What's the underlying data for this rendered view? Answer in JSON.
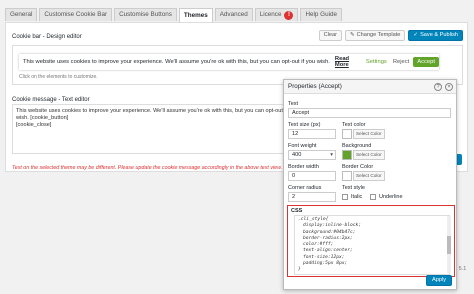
{
  "tabs": [
    {
      "label": "General"
    },
    {
      "label": "Customise Cookie Bar"
    },
    {
      "label": "Customise Buttons"
    },
    {
      "label": "Themes"
    },
    {
      "label": "Advanced"
    },
    {
      "label": "Licence",
      "badge": "!"
    },
    {
      "label": "Help Guide"
    }
  ],
  "designer": {
    "title": "Cookie bar - Design editor",
    "clear_label": "Clear",
    "change_template_label": "Change Template",
    "save_publish_label": "Save & Publish"
  },
  "preview": {
    "message": "This website uses cookies to improve your experience. We'll assume you're ok with this, but you can opt-out if you wish.",
    "read_more": "Read More",
    "settings": "Settings",
    "reject": "Reject",
    "accept": "Accept",
    "hint": "Click on the elements to customize."
  },
  "message_editor": {
    "label": "Cookie message - Text editor",
    "line1": "This website uses cookies to improve your experience. We'll assume you're ok with this, but you can opt-out if you",
    "line2": "wish. [cookie_button]",
    "line3": "[cookie_close]"
  },
  "warning": "Text on the selected theme may be different. Please update the cookie message accordingly in the above text view.",
  "version_text": "on 5.1",
  "properties": {
    "title": "Properties (Accept)",
    "text_label": "Text",
    "text_value": "Accept",
    "text_size_label": "Text size (px)",
    "text_size_value": "12",
    "text_color_label": "Text color",
    "text_color_button": "Select Color",
    "text_color": "#ffffff",
    "font_weight_label": "Font weight",
    "font_weight_value": "400",
    "background_label": "Background",
    "background_button": "Select Color",
    "background_color": "#62a329",
    "border_width_label": "Border width",
    "border_width_value": "0",
    "border_color_label": "Border Color",
    "border_color_button": "Select Color",
    "border_color": "#ffffff",
    "corner_radius_label": "Corner radius",
    "corner_radius_value": "2",
    "text_style_label": "Text style",
    "italic_label": "Italic",
    "underline_label": "Underline",
    "css_label": "CSS",
    "css_lines": [
      ".cli_style{",
      "display:inline-block;",
      "background:#04b47c;",
      "border-radius:2px;",
      "color:#fff;",
      "text-align:center;",
      "font-size:12px;",
      "padding:5px 8px;",
      "}"
    ],
    "apply_label": "Apply"
  }
}
